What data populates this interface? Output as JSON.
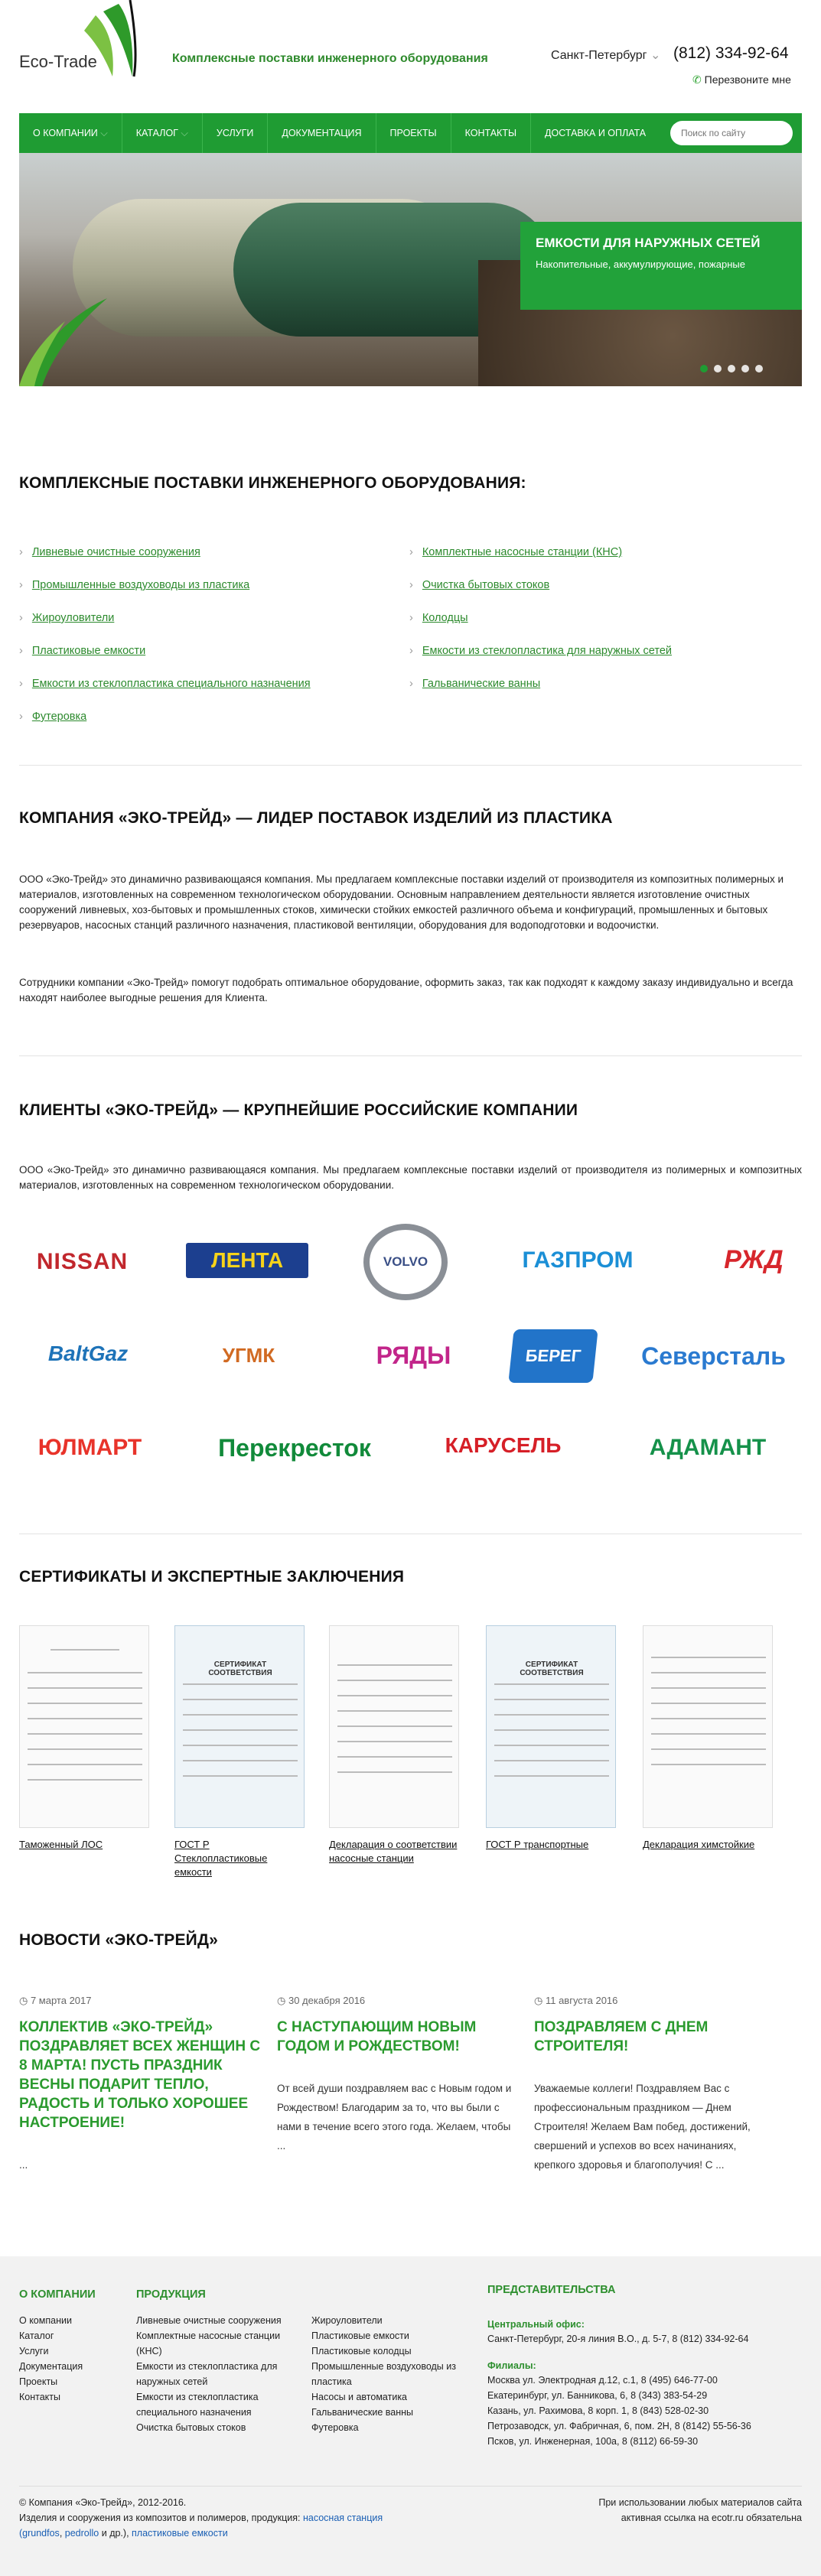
{
  "header": {
    "logo_text": "Eco-Trade",
    "tagline": "Комплексные поставки инженерного оборудования",
    "city": "Санкт-Петербург",
    "phone": "(812) 334-92-64",
    "callback": "Перезвоните мне"
  },
  "nav": {
    "items": [
      "О КОМПАНИИ",
      "КАТАЛОГ",
      "УСЛУГИ",
      "ДОКУМЕНТАЦИЯ",
      "ПРОЕКТЫ",
      "КОНТАКТЫ",
      "ДОСТАВКА И ОПЛАТА"
    ],
    "search_placeholder": "Поиск по сайту"
  },
  "hero": {
    "title": "ЕМКОСТИ ДЛЯ НАРУЖНЫХ СЕТЕЙ",
    "subtitle": "Накопительные, аккумулирующие, пожарные",
    "active_slide": 1,
    "slides": 5
  },
  "supply": {
    "heading": "КОМПЛЕКСНЫЕ ПОСТАВКИ ИНЖЕНЕРНОГО ОБОРУДОВАНИЯ:",
    "left": [
      "Ливневые очистные сооружения",
      "Промышленные воздуховоды из пластика",
      "Жироуловители",
      "Пластиковые емкости",
      "Емкости из стеклопластика специального назначения",
      "Футеровка"
    ],
    "right": [
      "Комплектные насосные станции (КНС)",
      "Очистка бытовых стоков",
      "Колодцы",
      "Емкости из стеклопластика для наружных сетей",
      "Гальванические ванны"
    ]
  },
  "about": {
    "heading": "КОМПАНИЯ «ЭКО-ТРЕЙД» — ЛИДЕР ПОСТАВОК ИЗДЕЛИЙ ИЗ ПЛАСТИКА",
    "p1": "ООО «Эко-Трейд» это динамично развивающаяся компания. Мы предлагаем комплексные поставки изделий от производителя из композитных полимерных и материалов, изготовленных на современном технологическом оборудовании. Основным направлением деятельности является изготовление очистных сооружений ливневых, хоз-бытовых и промышленных стоков, химически стойких емкостей различного объема и конфигураций, промышленных и бытовых резервуаров, насосных станций различного назначения, пластиковой вентиляции, оборудования для водоподготовки и водоочистки.",
    "p2": "Сотрудники компании «Эко-Трейд» помогут подобрать оптимальное оборудование, оформить заказ, так как подходят к каждому заказу индивидуально и всегда находят наиболее выгодные решения для Клиента."
  },
  "clients": {
    "heading": "КЛИЕНТЫ «ЭКО-ТРЕЙД» — КРУПНЕЙШИЕ РОССИЙСКИЕ КОМПАНИИ",
    "intro": "ООО «Эко-Трейд» это динамично развивающаяся компания. Мы предлагаем комплексные поставки изделий от производителя из полимерных и композитных материалов, изготовленных на современном технологическом оборудовании.",
    "logos": [
      "NISSAN",
      "ЛЕНТА",
      "VOLVO",
      "ГАЗПРОМ",
      "РЖД",
      "BaltGaz",
      "УГМК",
      "РЯДЫ",
      "БЕРЕГ",
      "Северсталь",
      "ЮЛМАРТ",
      "Перекресток",
      "КАРУСЕЛЬ",
      "АДАМАНТ"
    ]
  },
  "certs": {
    "heading": "СЕРТИФИКАТЫ И ЭКСПЕРТНЫЕ ЗАКЛЮЧЕНИЯ",
    "items": [
      "Таможенный ЛОС",
      "ГОСТ Р Стеклопластиковые емкости",
      "Декларация о соответствии насосные станции",
      "ГОСТ Р транспортные",
      "Декларация химстойкие"
    ],
    "doc_title": "СЕРТИФИКАТ СООТВЕТСТВИЯ"
  },
  "news": {
    "heading": "НОВОСТИ «ЭКО-ТРЕЙД»",
    "items": [
      {
        "date": "7 марта 2017",
        "title": "КОЛЛЕКТИВ «ЭКО-ТРЕЙД» ПОЗДРАВЛЯЕТ ВСЕХ ЖЕНЩИН С 8 МАРТА! ПУСТЬ ПРАЗДНИК ВЕСНЫ ПОДАРИТ ТЕПЛО, РАДОСТЬ И ТОЛЬКО ХОРОШЕЕ НАСТРОЕНИЕ!",
        "text": "..."
      },
      {
        "date": "30 декабря 2016",
        "title": "С НАСТУПАЮЩИМ НОВЫМ ГОДОМ И РОЖДЕСТВОМ!",
        "text": "От всей души поздравляем вас с Новым годом и Рождеством! Благодарим за то, что вы были с нами в течение всего этого года. Желаем, чтобы ..."
      },
      {
        "date": "11 августа 2016",
        "title": "ПОЗДРАВЛЯЕМ С ДНЕМ СТРОИТЕЛЯ!",
        "text": "Уважаемые коллеги! Поздравляем Вас с профессиональным праздником — Днем Строителя! Желаем Вам побед, достижений, свершений и успехов во всех начинаниях, крепкого здоровья и благополучия! С ..."
      }
    ]
  },
  "footer": {
    "col1_title": "О КОМПАНИИ",
    "col1": [
      "О компании",
      "Каталог",
      "Услуги",
      "Документация",
      "Проекты",
      "Контакты"
    ],
    "col2_title": "ПРОДУКЦИЯ",
    "col2": [
      "Ливневые очистные сооружения",
      "Комплектные насосные станции (КНС)",
      "Емкости из стеклопластика для наружных сетей",
      "Емкости из стеклопластика специального назначения",
      "Очистка бытовых стоков"
    ],
    "col3": [
      "Жироуловители",
      "Пластиковые емкости",
      "Пластиковые колодцы",
      "Промышленные воздуховоды из пластика",
      "Насосы и автоматика",
      "Гальванические ванны",
      "Футеровка"
    ],
    "col4_title": "ПРЕДСТАВИТЕЛЬСТВА",
    "head_office_label": "Центральный офис:",
    "head_office": "Санкт-Петербург, 20-я линия В.О., д. 5-7, 8 (812) 334-92-64",
    "branches_label": "Филиалы:",
    "branches": [
      "Москва ул. Электродная д.12, с.1, 8 (495) 646-77-00",
      "Екатеринбург, ул. Банникова, 6, 8 (343) 383-54-29",
      "Казань, ул. Рахимова, 8 корп. 1, 8 (843) 528-02-30",
      "Петрозаводск, ул. Фабричная, 6, пом. 2Н, 8 (8142) 55-56-36",
      "Псков, ул. Инженерная, 100а, 8 (8112) 66-59-30"
    ],
    "copyright": "© Компания «Эко-Трейд», 2012-2016.",
    "products_line": "Изделия и сооружения из композитов и полимеров, продукция:",
    "link1": "насосная станция",
    "link2": "(grundfos",
    "link3": "pedrollo",
    "link4": "пластиковые емкости",
    "and_others": "и др.),",
    "notice1": "При использовании любых материалов сайта",
    "notice2": "активная ссылка на ecotr.ru обязательна"
  }
}
